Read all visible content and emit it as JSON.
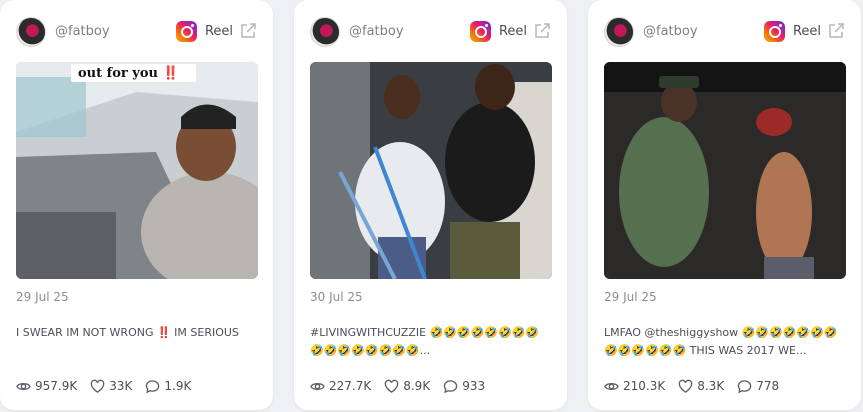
{
  "posts": [
    {
      "handle": "@fatboy",
      "type_label": "Reel",
      "overlay_text": "out for you ‼️",
      "date": "29 Jul 25",
      "caption": "I SWEAR IM NOT WRONG ‼️ IM SERIOUS",
      "views": "957.9K",
      "likes": "33K",
      "comments": "1.9K"
    },
    {
      "handle": "@fatboy",
      "type_label": "Reel",
      "date": "30 Jul 25",
      "caption": "#LIVINGWITHCUZZIE 🤣🤣🤣🤣🤣🤣🤣🤣🤣🤣🤣🤣🤣🤣🤣🤣...",
      "views": "227.7K",
      "likes": "8.9K",
      "comments": "933"
    },
    {
      "handle": "@fatboy",
      "type_label": "Reel",
      "date": "29 Jul 25",
      "caption": "LMFAO @theshiggyshow 🤣🤣🤣🤣🤣🤣🤣🤣🤣🤣🤣🤣🤣 THIS WAS 2017 WE...",
      "views": "210.3K",
      "likes": "8.3K",
      "comments": "778"
    }
  ],
  "icons": {
    "platform": "instagram-icon",
    "open": "external-link-icon",
    "views": "eye-icon",
    "likes": "heart-icon",
    "comments": "comment-icon"
  },
  "colors": {
    "background": "#eef0f3",
    "card": "#ffffff",
    "text": "#4a4e58",
    "muted": "#8a8e98"
  }
}
